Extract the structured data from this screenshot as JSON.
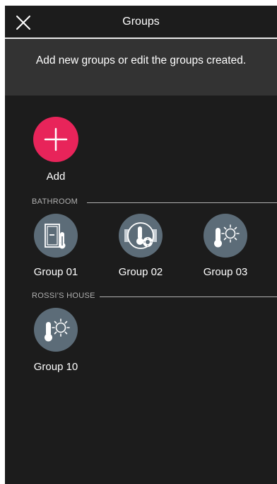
{
  "header": {
    "title": "Groups"
  },
  "info": {
    "text": "Add new groups or edit the groups created."
  },
  "add": {
    "label": "Add",
    "color": "#e8245a"
  },
  "sections": [
    {
      "title": "BATHROOM",
      "groups": [
        {
          "label": "Group 01",
          "icon": "window-thermostat-icon"
        },
        {
          "label": "Group 02",
          "icon": "shutter-thermostat-icon"
        },
        {
          "label": "Group 03",
          "icon": "thermostat-sun-icon"
        }
      ]
    },
    {
      "title": "ROSSI'S HOUSE",
      "groups": [
        {
          "label": "Group 10",
          "icon": "thermostat-sun-icon"
        }
      ]
    }
  ],
  "colors": {
    "background": "#1c1c1c",
    "banner": "#333333",
    "icon_circle": "#5c6c78"
  }
}
